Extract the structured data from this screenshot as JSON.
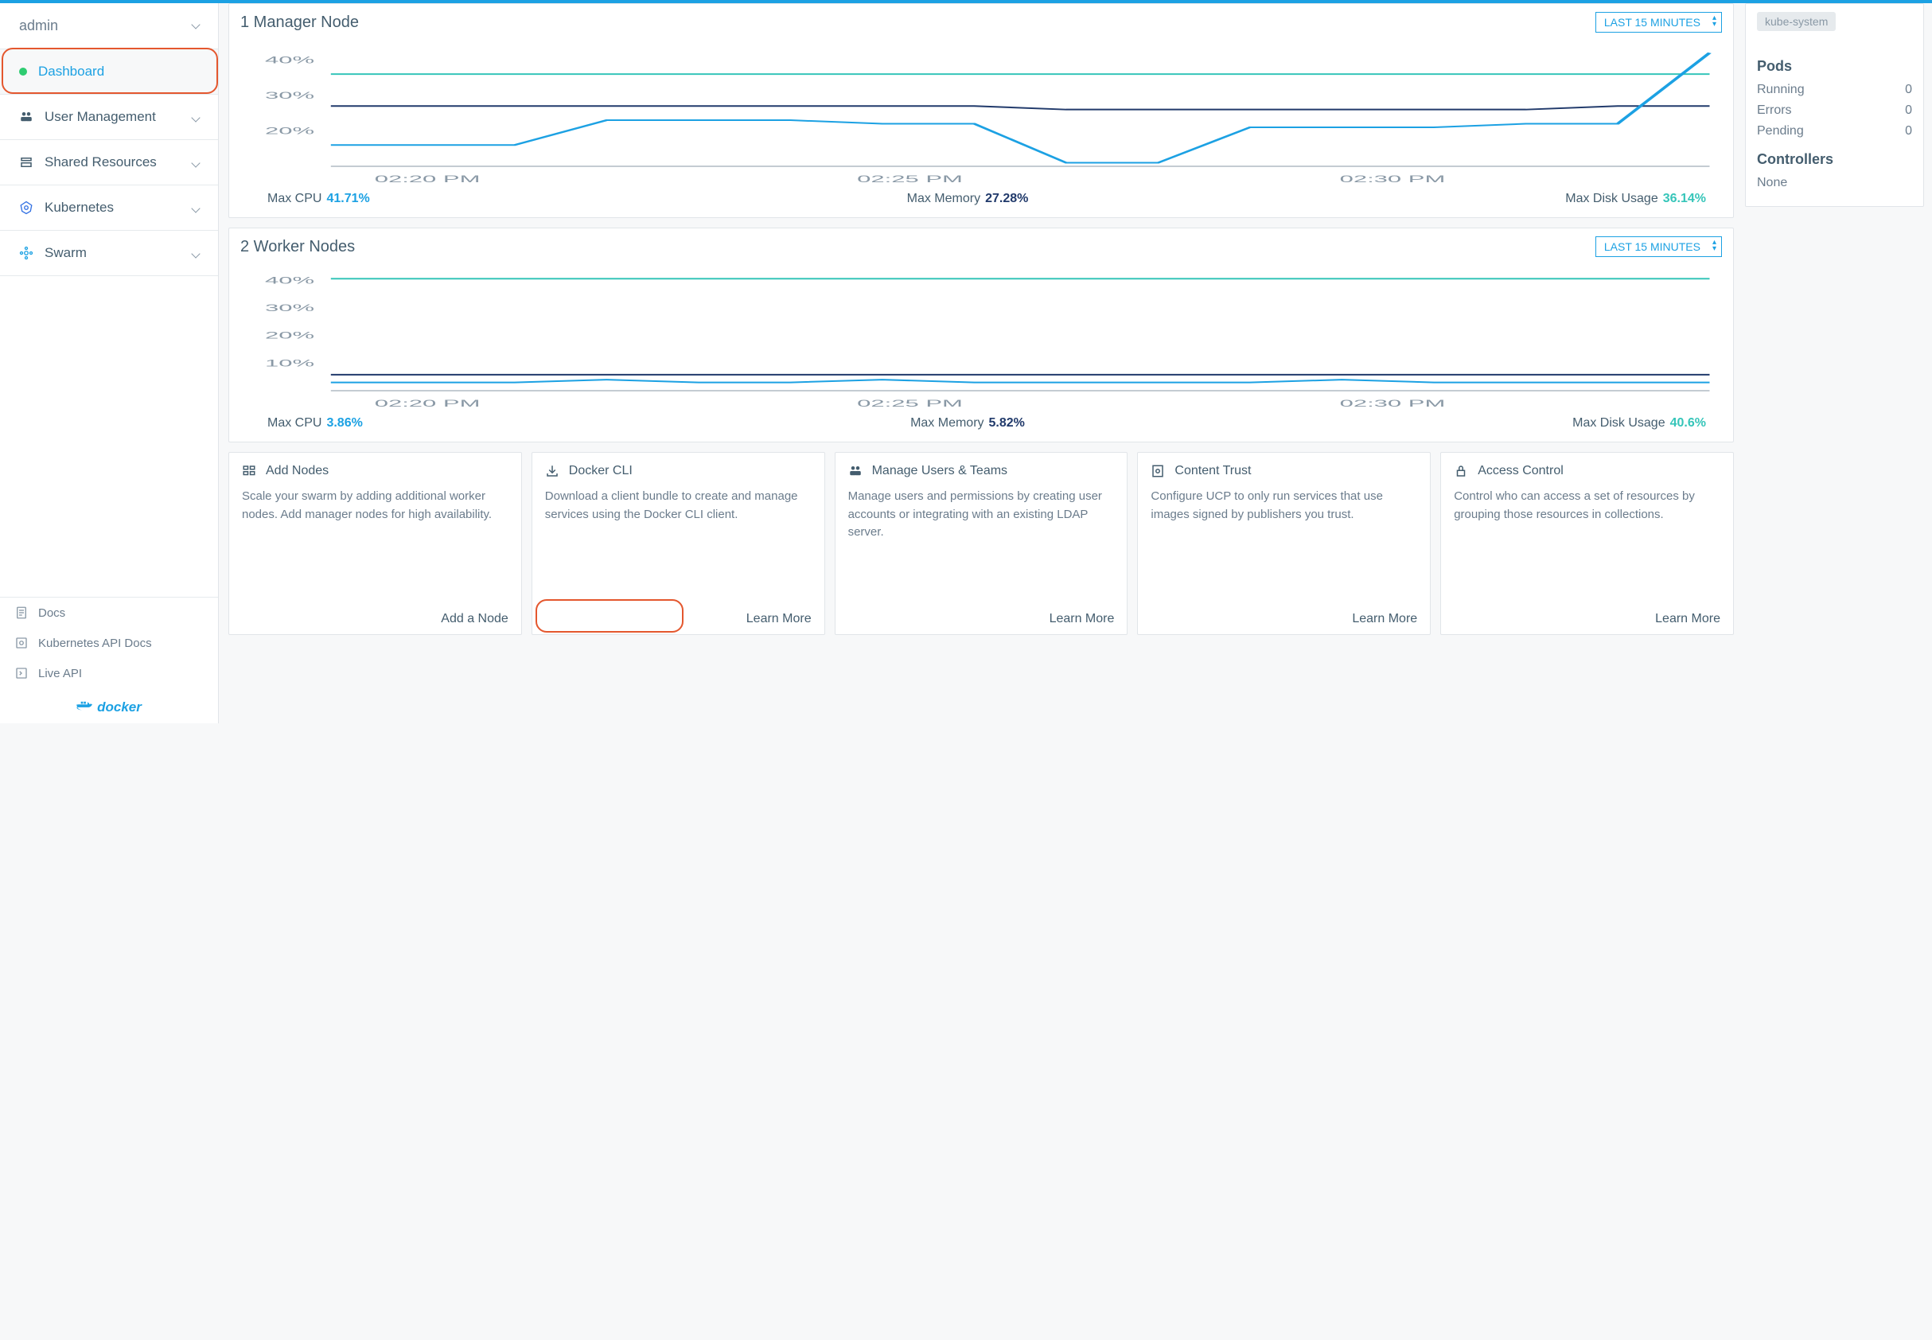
{
  "sidebar": {
    "user": "admin",
    "items": [
      {
        "label": "Dashboard"
      },
      {
        "label": "User Management"
      },
      {
        "label": "Shared Resources"
      },
      {
        "label": "Kubernetes"
      },
      {
        "label": "Swarm"
      }
    ],
    "footer": {
      "docs": "Docs",
      "k8s_api": "Kubernetes API Docs",
      "live_api": "Live API"
    },
    "logo": "docker"
  },
  "manager": {
    "title": "1 Manager Node",
    "time_range": "LAST 15 MINUTES",
    "metrics": {
      "cpu_label": "Max CPU",
      "cpu_value": "41.71%",
      "mem_label": "Max Memory",
      "mem_value": "27.28%",
      "disk_label": "Max Disk Usage",
      "disk_value": "36.14%"
    }
  },
  "worker": {
    "title": "2 Worker Nodes",
    "time_range": "LAST 15 MINUTES",
    "metrics": {
      "cpu_label": "Max CPU",
      "cpu_value": "3.86%",
      "mem_label": "Max Memory",
      "mem_value": "5.82%",
      "disk_label": "Max Disk Usage",
      "disk_value": "40.6%"
    }
  },
  "chart_data": [
    {
      "type": "line",
      "title": "1 Manager Node",
      "x_ticks": [
        "02:20 PM",
        "02:25 PM",
        "02:30 PM"
      ],
      "y_ticks": [
        "20%",
        "30%",
        "40%"
      ],
      "ylim": [
        10,
        45
      ],
      "series": [
        {
          "name": "Max Disk Usage",
          "color": "#36c5b9",
          "values": [
            36,
            36,
            36,
            36,
            36,
            36,
            36,
            36,
            36,
            36,
            36,
            36,
            36,
            36,
            36,
            36
          ]
        },
        {
          "name": "Max Memory",
          "color": "#213a6b",
          "values": [
            27,
            27,
            27,
            27,
            27,
            27,
            27,
            27,
            26,
            26,
            26,
            26,
            26,
            26,
            27,
            27
          ]
        },
        {
          "name": "Max CPU",
          "color": "#1ca1e3",
          "values": [
            16,
            16,
            16,
            23,
            23,
            23,
            22,
            22,
            11,
            11,
            21,
            21,
            21,
            22,
            22,
            42
          ]
        }
      ]
    },
    {
      "type": "line",
      "title": "2 Worker Nodes",
      "x_ticks": [
        "02:20 PM",
        "02:25 PM",
        "02:30 PM"
      ],
      "y_ticks": [
        "10%",
        "20%",
        "30%",
        "40%"
      ],
      "ylim": [
        0,
        45
      ],
      "series": [
        {
          "name": "Max Disk Usage",
          "color": "#36c5b9",
          "values": [
            40.6,
            40.6,
            40.6,
            40.6,
            40.6,
            40.6,
            40.6,
            40.6,
            40.6,
            40.6,
            40.6,
            40.6,
            40.6,
            40.6,
            40.6,
            40.6
          ]
        },
        {
          "name": "Max Memory",
          "color": "#213a6b",
          "values": [
            5.8,
            5.8,
            5.8,
            5.8,
            5.8,
            5.8,
            5.8,
            5.8,
            5.8,
            5.8,
            5.8,
            5.8,
            5.8,
            5.8,
            5.8,
            5.8
          ]
        },
        {
          "name": "Max CPU",
          "color": "#1ca1e3",
          "values": [
            3,
            3,
            3,
            4,
            3,
            3,
            4,
            3,
            3,
            3,
            3,
            4,
            3,
            3,
            3,
            3
          ]
        }
      ]
    }
  ],
  "tiles": [
    {
      "title": "Add Nodes",
      "body": "Scale your swarm by adding additional worker nodes. Add manager nodes for high availability.",
      "action": "Add a Node"
    },
    {
      "title": "Docker CLI",
      "body": "Download a client bundle to create and manage services using the Docker CLI client.",
      "action": "Learn More"
    },
    {
      "title": "Manage Users & Teams",
      "body": "Manage users and permissions by creating user accounts or integrating with an existing LDAP server.",
      "action": "Learn More"
    },
    {
      "title": "Content Trust",
      "body": "Configure UCP to only run services that use images signed by publishers you trust.",
      "action": "Learn More"
    },
    {
      "title": "Access Control",
      "body": "Control who can access a set of resources by grouping those resources in collections.",
      "action": "Learn More"
    }
  ],
  "right": {
    "chip": "kube-system",
    "pods_title": "Pods",
    "pods": {
      "running_label": "Running",
      "running": "0",
      "errors_label": "Errors",
      "errors": "0",
      "pending_label": "Pending",
      "pending": "0"
    },
    "controllers_title": "Controllers",
    "controllers_none": "None"
  }
}
